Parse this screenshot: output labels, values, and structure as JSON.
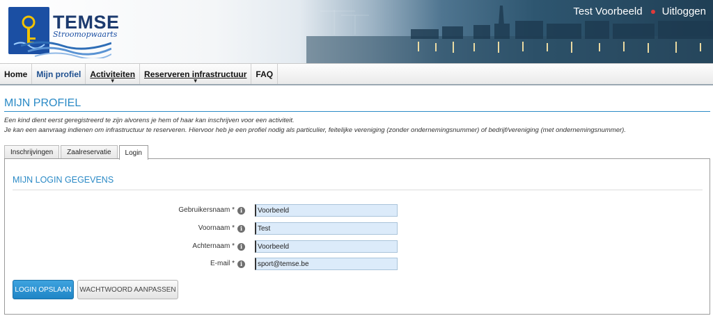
{
  "header": {
    "logo_title": "TEMSE",
    "logo_subtitle": "Stroomopwaarts",
    "user_name": "Test Voorbeeld",
    "logout": "Uitloggen"
  },
  "nav": {
    "items": [
      {
        "label": "Home"
      },
      {
        "label": "Mijn profiel"
      },
      {
        "label": "Activiteiten"
      },
      {
        "label": "Reserveren infrastructuur"
      },
      {
        "label": "FAQ"
      }
    ]
  },
  "page": {
    "title": "MIJN PROFIEL",
    "intro_line1": "Een kind dient eerst geregistreerd te zijn alvorens je hem of haar kan inschrijven voor een activiteit.",
    "intro_line2": "Je kan een aanvraag indienen om infrastructuur te reserveren. Hiervoor heb je een profiel nodig als particulier, feitelijke vereniging (zonder ondernemingsnummer) of bedrijf/vereniging (met ondernemingsnummer)."
  },
  "tabs": [
    {
      "label": "Inschrijvingen"
    },
    {
      "label": "Zaalreservatie"
    },
    {
      "label": "Login"
    }
  ],
  "panel": {
    "title": "MIJN LOGIN GEGEVENS",
    "fields": [
      {
        "label": "Gebruikersnaam *",
        "value": "Voorbeeld"
      },
      {
        "label": "Voornaam *",
        "value": "Test"
      },
      {
        "label": "Achternaam *",
        "value": "Voorbeeld"
      },
      {
        "label": "E-mail *",
        "value": "sport@temse.be"
      }
    ],
    "info_glyph": "i",
    "save_button": "LOGIN OPSLAAN",
    "password_button": "WACHTWOORD AANPASSEN"
  },
  "colors": {
    "accent": "#2b8ac6",
    "primary_button": "#1f85c6",
    "input_bg": "#dcebfa"
  }
}
